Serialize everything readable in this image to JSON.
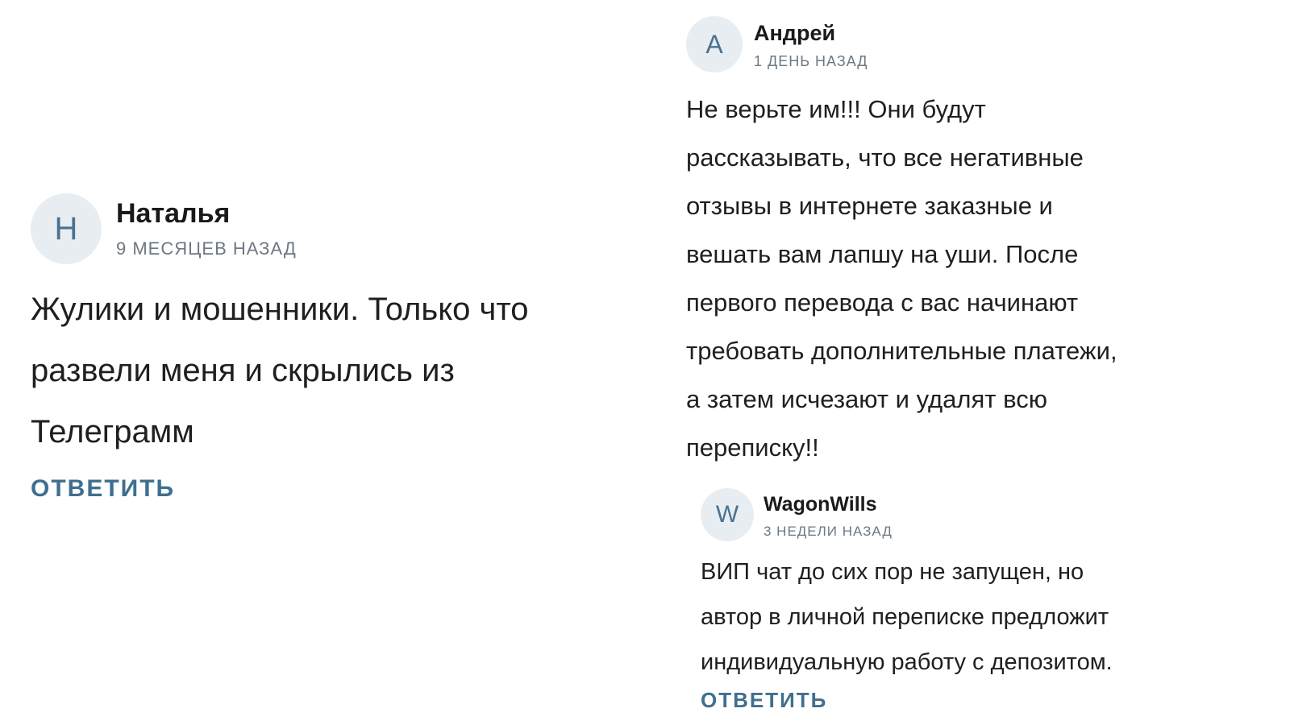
{
  "comments": [
    {
      "avatar_letter": "Н",
      "author": "Наталья",
      "time": "9 МЕСЯЦЕВ НАЗАД",
      "text": "Жулики и мошенники. Только что\nразвели меня и скрылись из\nТелеграмм",
      "reply_label": "ОТВЕТИТЬ"
    },
    {
      "avatar_letter": "А",
      "author": "Андрей",
      "time": "1 ДЕНЬ НАЗАД",
      "text": "Не верьте им!!! Они будут\nрассказывать, что все негативные\nотзывы в интернете заказные и\nвешать вам лапшу на уши. После\nпервого перевода с вас начинают\nтребовать дополнительные платежи,\nа затем исчезают и удалят всю\nпереписку!!"
    },
    {
      "avatar_letter": "W",
      "author": "WagonWills",
      "time": "3 НЕДЕЛИ НАЗАД",
      "text": "ВИП чат до сих пор не запущен, но\nавтор в личной переписке предложит\nиндивидуальную работу с депозитом.",
      "reply_label": "ОТВЕТИТЬ"
    }
  ],
  "colors": {
    "avatar_bg": "#e8edf1",
    "avatar_letter": "#4a7390",
    "reply_link": "#3f6f8f",
    "timestamp": "#6c7884"
  }
}
